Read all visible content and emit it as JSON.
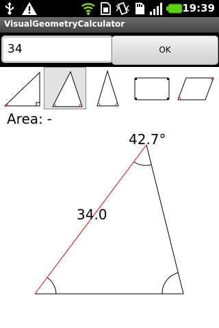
{
  "status_bar": {
    "time": "19:39",
    "icons": [
      "usb-icon",
      "warning-icon",
      "wifi-icon",
      "sim-icon",
      "vibrate-icon",
      "sd-card-icon",
      "signal-icon",
      "battery-icon"
    ]
  },
  "app": {
    "title": "VisualGeometryCalculator"
  },
  "input": {
    "value": "34",
    "ok_label": "OK"
  },
  "shapes": {
    "items": [
      "right-triangle",
      "triangle",
      "isosceles-triangle",
      "rectangle",
      "parallelogram"
    ],
    "selected": "triangle"
  },
  "area": {
    "label": "Area:",
    "value": "-"
  },
  "figure": {
    "angle_label": "42.7°",
    "side_label": "34.0",
    "colors": {
      "highlight": "#ff0000",
      "line": "#000000"
    }
  }
}
